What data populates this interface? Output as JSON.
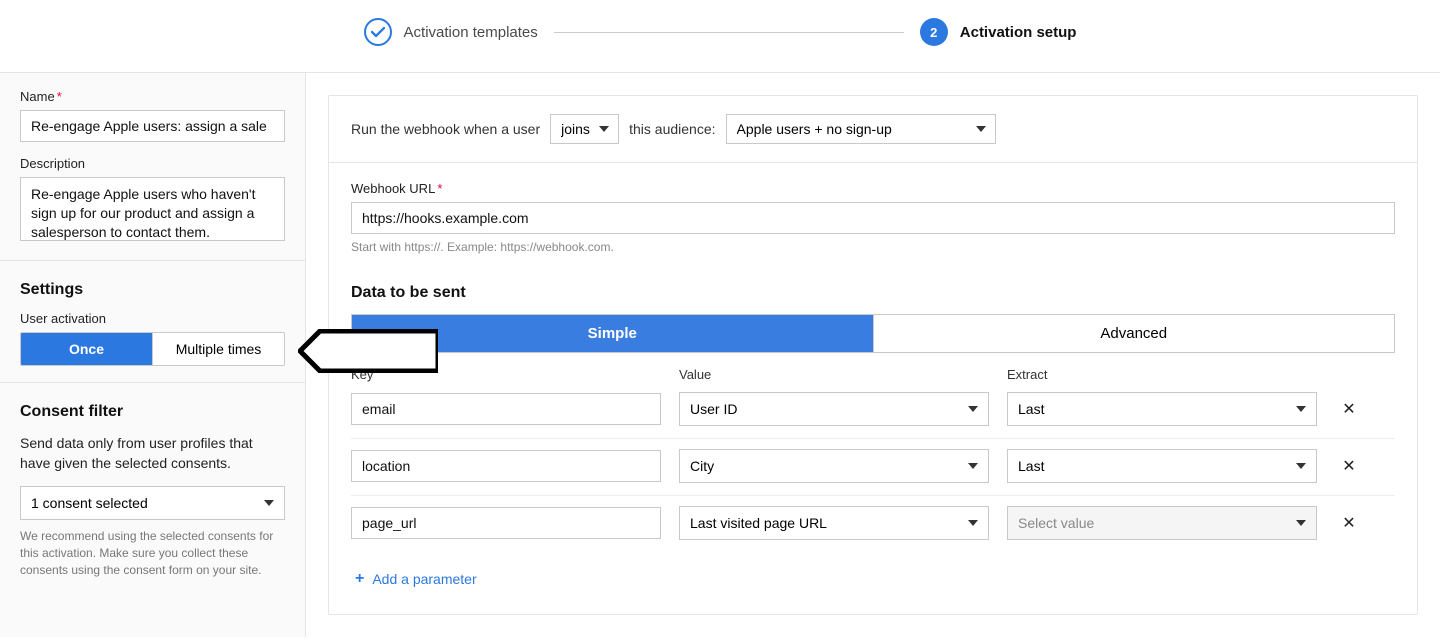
{
  "stepper": {
    "step1_label": "Activation templates",
    "step2_num": "2",
    "step2_label": "Activation setup"
  },
  "sidebar": {
    "name_label": "Name",
    "name_value": "Re-engage Apple users: assign a sale",
    "desc_label": "Description",
    "desc_value": "Re-engage Apple users who haven't sign up for our product and assign a salesperson to contact them.",
    "settings_title": "Settings",
    "activation_label": "User activation",
    "activation_once": "Once",
    "activation_multi": "Multiple times",
    "consent_title": "Consent filter",
    "consent_desc": "Send data only from user profiles that have given the selected consents.",
    "consent_value": "1 consent selected",
    "consent_help": "We recommend using the selected consents for this activation. Make sure you collect these consents using the consent form on your site."
  },
  "main": {
    "run_prefix": "Run the webhook when a user",
    "run_trigger": "joins",
    "run_mid": "this audience:",
    "audience": "Apple users + no sign-up",
    "url_label": "Webhook URL",
    "url_value": "https://hooks.example.com",
    "url_hint": "Start with https://. Example: https://webhook.com.",
    "data_title": "Data to be sent",
    "tab_simple": "Simple",
    "tab_advanced": "Advanced",
    "col_key": "Key",
    "col_value": "Value",
    "col_extract": "Extract",
    "rows": [
      {
        "key": "email",
        "value": "User ID",
        "extract": "Last"
      },
      {
        "key": "location",
        "value": "City",
        "extract": "Last"
      },
      {
        "key": "page_url",
        "value": "Last visited page URL",
        "extract": "Select value"
      }
    ],
    "add_param": "Add a parameter"
  }
}
